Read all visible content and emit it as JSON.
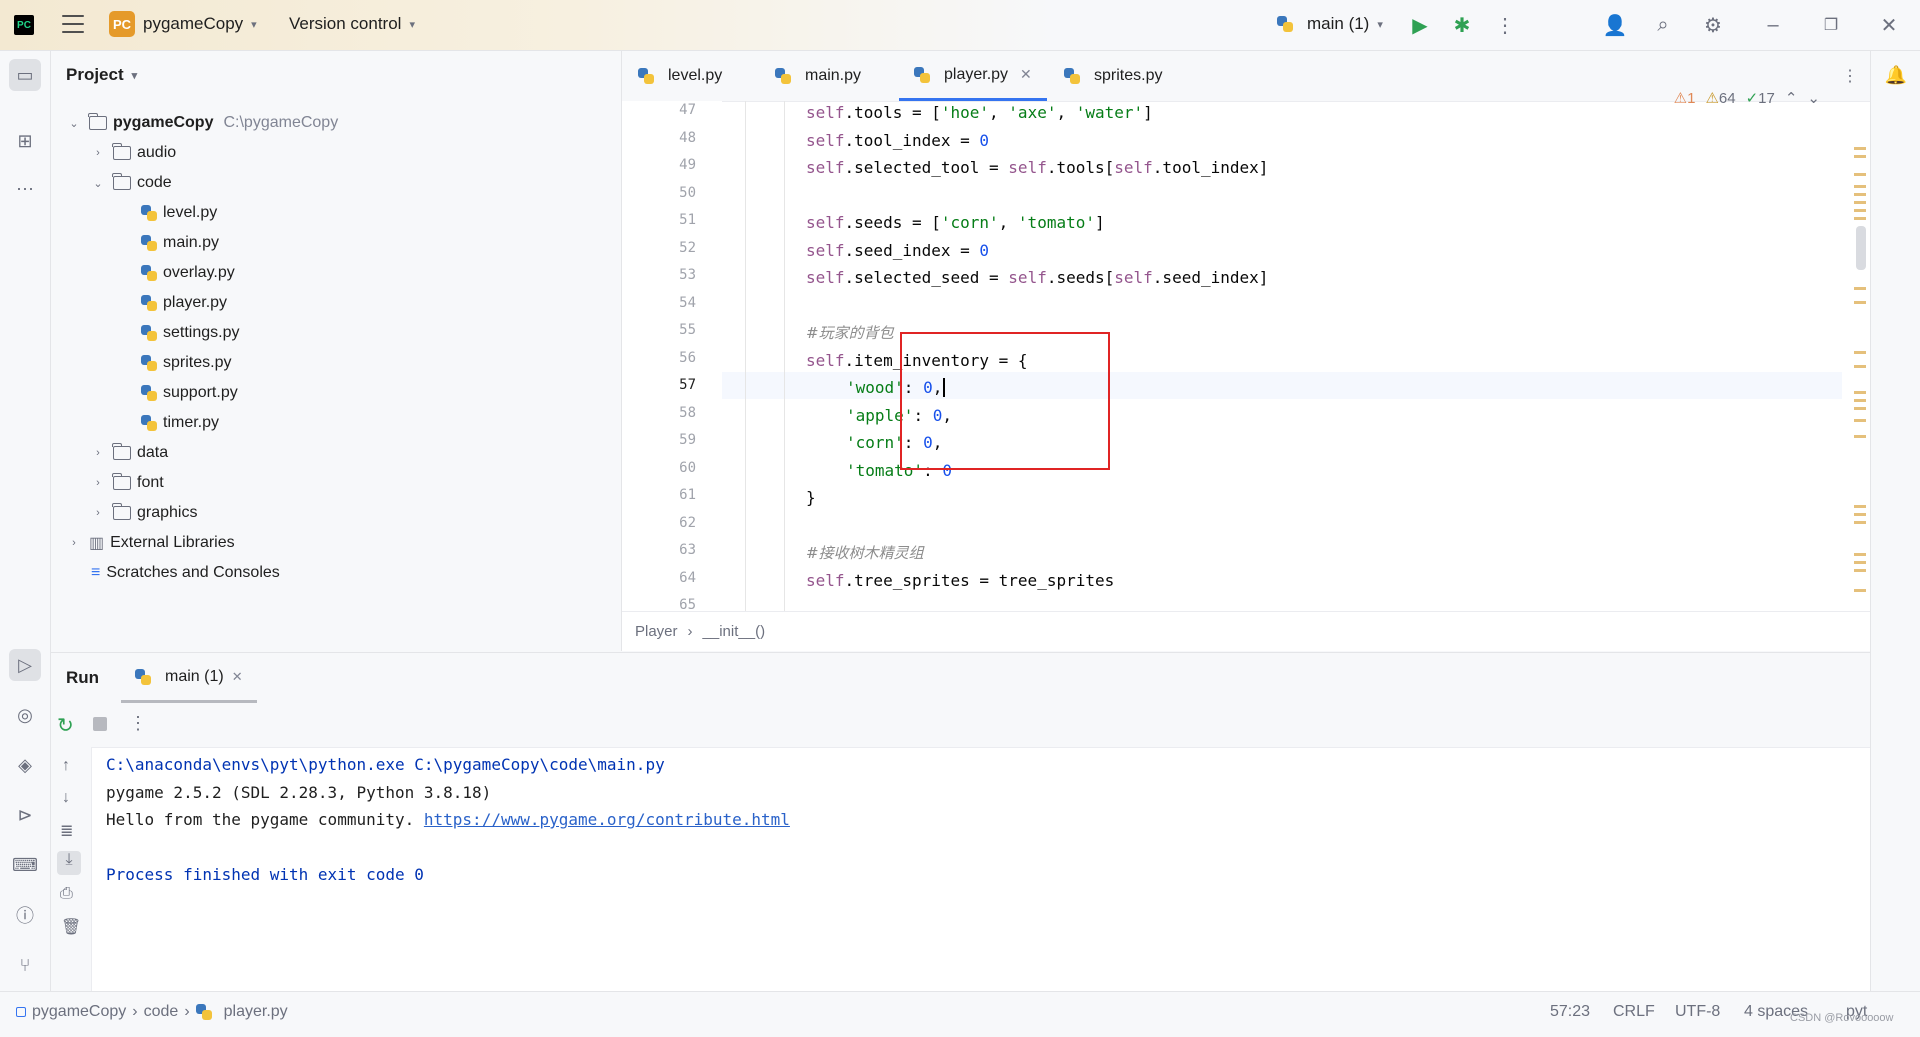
{
  "titlebar": {
    "project_badge": "PC",
    "project_name": "pygameCopy",
    "vcs_label": "Version control",
    "run_config": "main (1)",
    "logo_text": "PC"
  },
  "project_panel": {
    "title": "Project",
    "root": {
      "name": "pygameCopy",
      "path": "C:\\pygameCopy"
    },
    "items": [
      {
        "label": "audio",
        "type": "folder",
        "expanded": false
      },
      {
        "label": "code",
        "type": "folder",
        "expanded": true
      },
      {
        "label": "level.py",
        "type": "py"
      },
      {
        "label": "main.py",
        "type": "py"
      },
      {
        "label": "overlay.py",
        "type": "py"
      },
      {
        "label": "player.py",
        "type": "py"
      },
      {
        "label": "settings.py",
        "type": "py"
      },
      {
        "label": "sprites.py",
        "type": "py"
      },
      {
        "label": "support.py",
        "type": "py"
      },
      {
        "label": "timer.py",
        "type": "py"
      },
      {
        "label": "data",
        "type": "folder",
        "expanded": false
      },
      {
        "label": "font",
        "type": "folder",
        "expanded": false
      },
      {
        "label": "graphics",
        "type": "folder",
        "expanded": false
      }
    ],
    "external_libraries": "External Libraries",
    "scratches": "Scratches and Consoles"
  },
  "editor": {
    "tabs": [
      {
        "label": "level.py"
      },
      {
        "label": "main.py"
      },
      {
        "label": "player.py",
        "active": true
      },
      {
        "label": "sprites.py"
      }
    ],
    "inspections": {
      "errors": "1",
      "warnings": "64",
      "typos": "17"
    },
    "line_numbers": [
      "47",
      "48",
      "49",
      "50",
      "51",
      "52",
      "53",
      "54",
      "55",
      "56",
      "57",
      "58",
      "59",
      "60",
      "61",
      "62",
      "63",
      "64",
      "65"
    ],
    "current_line": "57",
    "code": {
      "l47": [
        "self",
        ".tools = [",
        "'hoe'",
        ", ",
        "'axe'",
        ", ",
        "'water'",
        "]"
      ],
      "l48": [
        "self",
        ".tool_index = ",
        "0"
      ],
      "l49": [
        "self",
        ".selected_tool = ",
        "self",
        ".tools[",
        "self",
        ".tool_index]"
      ],
      "l51": [
        "self",
        ".seeds = [",
        "'corn'",
        ", ",
        "'tomato'",
        "]"
      ],
      "l52": [
        "self",
        ".seed_index = ",
        "0"
      ],
      "l53": [
        "self",
        ".selected_seed = ",
        "self",
        ".seeds[",
        "self",
        ".seed_index]"
      ],
      "l55": "#玩家的背包",
      "l56": [
        "self",
        ".item_inventory = {"
      ],
      "l57": [
        "'wood'",
        ": ",
        "0",
        ","
      ],
      "l58": [
        "'apple'",
        ": ",
        "0",
        ","
      ],
      "l59": [
        "'corn'",
        ": ",
        "0",
        ","
      ],
      "l60": [
        "'tomato'",
        ": ",
        "0"
      ],
      "l61": "}",
      "l63": "#接收树木精灵组",
      "l64": [
        "self",
        ".tree_sprites = tree_sprites"
      ]
    },
    "breadcrumb": [
      "Player",
      "__init__()"
    ]
  },
  "run_panel": {
    "title": "Run",
    "tab": "main (1)",
    "console": [
      "C:\\anaconda\\envs\\pyt\\python.exe C:\\pygameCopy\\code\\main.py",
      "pygame 2.5.2 (SDL 2.28.3, Python 3.8.18)",
      "Hello from the pygame community. ",
      "",
      "Process finished with exit code 0"
    ],
    "console_link": "https://www.pygame.org/contribute.html"
  },
  "statusbar": {
    "path": [
      "pygameCopy",
      "code",
      "player.py"
    ],
    "position": "57:23",
    "line_sep": "CRLF",
    "encoding": "UTF-8",
    "indent": "4 spaces",
    "filetype": "pyt",
    "watermark": "CSDN @Rovooooow"
  },
  "colors": {
    "accent": "#3574f0",
    "highlight_box": "#e02424",
    "string": "#067d17",
    "number": "#1750eb",
    "self": "#94558d"
  }
}
